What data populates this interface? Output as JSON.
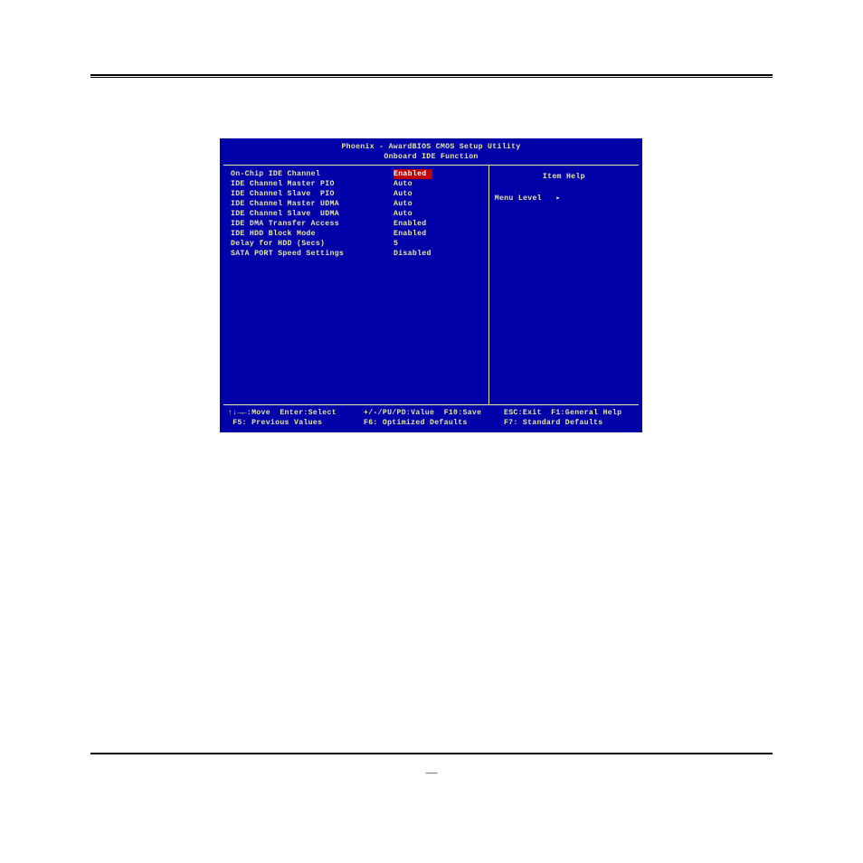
{
  "header": {
    "line1": "Phoenix - AwardBIOS CMOS Setup Utility",
    "line2": "Onboard IDE Function"
  },
  "settings": [
    {
      "label": "On-Chip IDE Channel",
      "value": "Enabled",
      "selected": true
    },
    {
      "label": "IDE Channel Master PIO",
      "value": "Auto",
      "selected": false
    },
    {
      "label": "IDE Channel Slave  PIO",
      "value": "Auto",
      "selected": false
    },
    {
      "label": "IDE Channel Master UDMA",
      "value": "Auto",
      "selected": false
    },
    {
      "label": "IDE Channel Slave  UDMA",
      "value": "Auto",
      "selected": false
    },
    {
      "label": "IDE DMA Transfer Access",
      "value": "Enabled",
      "selected": false
    },
    {
      "label": "IDE HDD Block Mode",
      "value": "Enabled",
      "selected": false
    },
    {
      "label": "Delay for HDD (Secs)",
      "value": "5",
      "selected": false
    },
    {
      "label": "SATA PORT Speed Settings",
      "value": "Disabled",
      "selected": false
    }
  ],
  "help": {
    "title": "Item Help",
    "menu_level": "Menu Level   ▸"
  },
  "footer": {
    "row1": {
      "c1": "↑↓→←:Move  Enter:Select",
      "c2": "+/-/PU/PD:Value  F10:Save",
      "c3": "ESC:Exit  F1:General Help"
    },
    "row2": {
      "c1": " F5: Previous Values",
      "c2": "F6: Optimized Defaults",
      "c3": "F7: Standard Defaults"
    }
  },
  "page_number": "—"
}
